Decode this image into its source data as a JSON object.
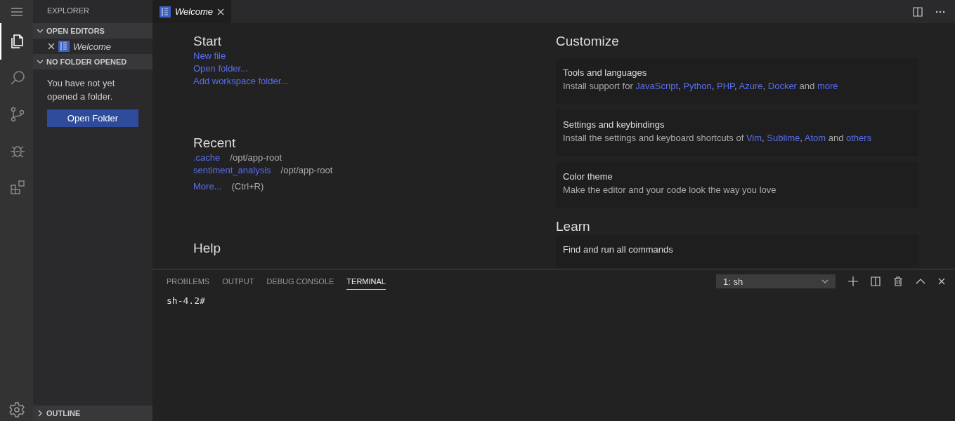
{
  "activity_bar": {
    "items": [
      {
        "selected": true
      },
      {
        "selected": false
      },
      {
        "selected": false
      },
      {
        "selected": false
      },
      {
        "selected": false
      }
    ]
  },
  "sidebar": {
    "title": "EXPLORER",
    "sections": [
      {
        "kind": "editors",
        "title": "OPEN EDITORS",
        "expanded": true,
        "items": [
          {
            "label": "Welcome"
          }
        ]
      },
      {
        "kind": "folder",
        "title": "NO FOLDER OPENED",
        "expanded": true,
        "message": "You have not yet opened a folder.",
        "button": "Open Folder"
      },
      {
        "kind": "outline",
        "title": "OUTLINE",
        "expanded": false
      }
    ]
  },
  "tabs": [
    {
      "label": "Welcome",
      "selected": true
    }
  ],
  "welcome": {
    "start": {
      "heading": "Start",
      "links": [
        "New file",
        "Open folder...",
        "Add workspace folder..."
      ]
    },
    "recent": {
      "heading": "Recent",
      "items": [
        {
          "name": ".cache",
          "path": "/opt/app-root"
        },
        {
          "name": "sentiment_analysis",
          "path": "/opt/app-root"
        }
      ],
      "more": {
        "label": "More...",
        "shortcut": "(Ctrl+R)"
      }
    },
    "help": {
      "heading": "Help"
    },
    "customize": {
      "heading": "Customize",
      "cards": [
        {
          "title": "Tools and languages",
          "description": [
            {
              "kind": "text",
              "text": "Install support for "
            },
            {
              "kind": "link",
              "text": "JavaScript"
            },
            {
              "kind": "text",
              "text": ", "
            },
            {
              "kind": "link",
              "text": "Python"
            },
            {
              "kind": "text",
              "text": ", "
            },
            {
              "kind": "link",
              "text": "PHP"
            },
            {
              "kind": "text",
              "text": ", "
            },
            {
              "kind": "link",
              "text": "Azure"
            },
            {
              "kind": "text",
              "text": ", "
            },
            {
              "kind": "link",
              "text": "Docker"
            },
            {
              "kind": "text",
              "text": " and "
            },
            {
              "kind": "link",
              "text": "more"
            }
          ]
        },
        {
          "title": "Settings and keybindings",
          "description": [
            {
              "kind": "text",
              "text": "Install the settings and keyboard shortcuts of "
            },
            {
              "kind": "link",
              "text": "Vim"
            },
            {
              "kind": "text",
              "text": ", "
            },
            {
              "kind": "link",
              "text": "Sublime"
            },
            {
              "kind": "text",
              "text": ", "
            },
            {
              "kind": "link",
              "text": "Atom"
            },
            {
              "kind": "text",
              "text": " and "
            },
            {
              "kind": "link",
              "text": "others"
            }
          ]
        },
        {
          "title": "Color theme",
          "description": [
            {
              "kind": "text",
              "text": "Make the editor and your code look the way you love"
            }
          ]
        }
      ]
    },
    "learn": {
      "heading": "Learn",
      "cards": [
        {
          "title": "Find and run all commands"
        }
      ]
    }
  },
  "panel": {
    "tabs": [
      {
        "label": "PROBLEMS",
        "selected": false
      },
      {
        "label": "OUTPUT",
        "selected": false
      },
      {
        "label": "DEBUG CONSOLE",
        "selected": false
      },
      {
        "label": "TERMINAL",
        "selected": true
      }
    ],
    "terminal_select": "1: sh",
    "terminal_lines": [
      "sh-4.2#"
    ]
  }
}
